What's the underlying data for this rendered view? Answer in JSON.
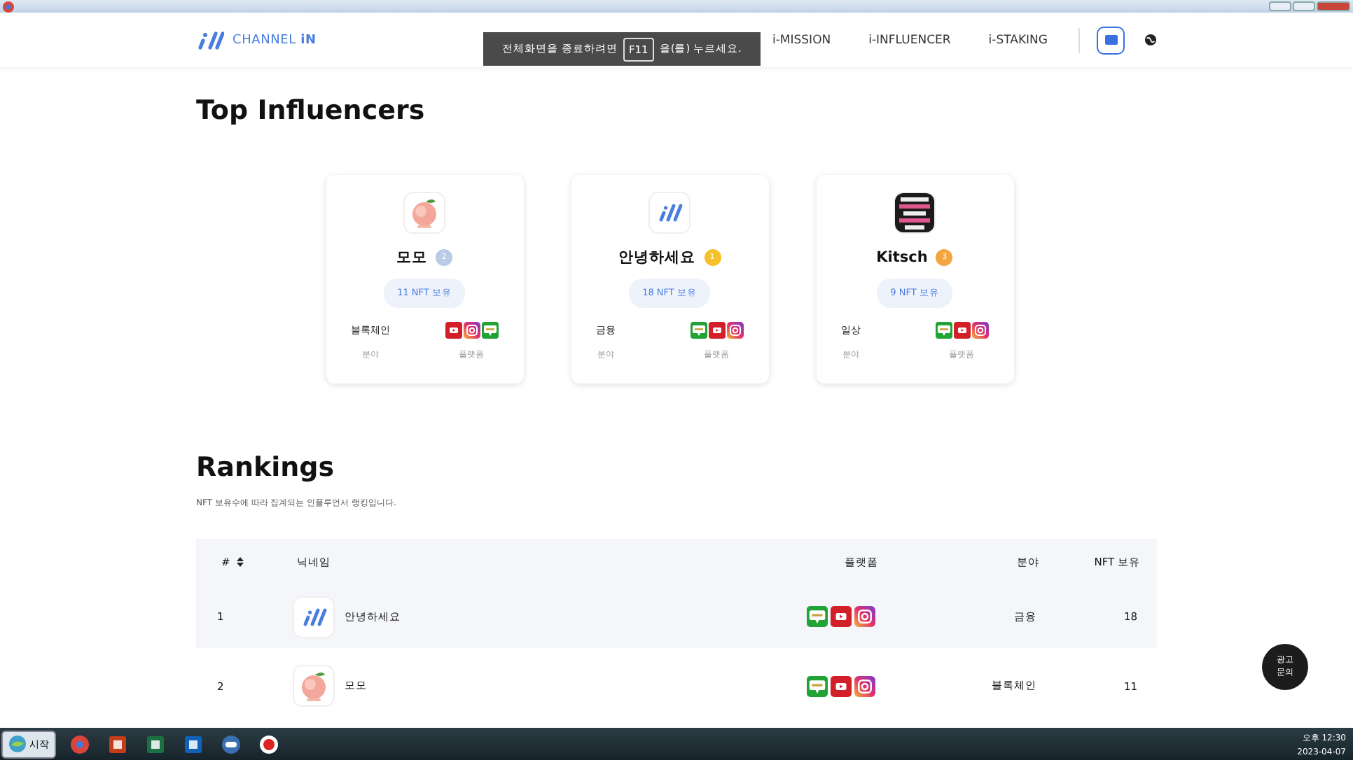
{
  "header": {
    "brand": "CHANNEL **iN**",
    "nav": [
      {
        "label": "i-MISSION"
      },
      {
        "label": "i-INFLUENCER"
      },
      {
        "label": "i-STAKING"
      }
    ]
  },
  "toast": {
    "before": "전체화면을 종료하려면",
    "key": "F11",
    "after": "을(를) 누르세요."
  },
  "top_section": {
    "title": "Top Influencers",
    "cards": [
      {
        "avatar": {
          "kind": "peach"
        },
        "name": "모모",
        "medal": {
          "rank": "2",
          "color": "#b9cbe6"
        },
        "nft": "11 NFT 보유",
        "field": "블록체인",
        "field_label": "분야",
        "platforms": [
          {
            "kind": "youtube"
          },
          {
            "kind": "instagram"
          },
          {
            "kind": "blog"
          }
        ],
        "platform_label": "플랫폼"
      },
      {
        "avatar": {
          "kind": "logo"
        },
        "name": "안녕하세요",
        "medal": {
          "rank": "1",
          "color": "#f5c02a"
        },
        "nft": "18 NFT 보유",
        "field": "금융",
        "field_label": "분야",
        "platforms": [
          {
            "kind": "blog"
          },
          {
            "kind": "youtube"
          },
          {
            "kind": "instagram"
          }
        ],
        "platform_label": "플랫폼"
      },
      {
        "name": "Kitsch",
        "medal": {
          "rank": "3",
          "color": "#f2a540"
        },
        "nft": "9 NFT 보유",
        "field": "일상",
        "field_label": "분야",
        "platforms": [
          {
            "kind": "blog"
          },
          {
            "kind": "youtube"
          },
          {
            "kind": "instagram"
          }
        ],
        "platform_label": "플랫폼"
      }
    ]
  },
  "rankings": {
    "title": "Rankings",
    "subtitle": "NFT 보유수에 따라 집계되는 인플루언서 랭킹입니다.",
    "columns": [
      "#",
      "닉네임",
      "플랫폼",
      "분야",
      "NFT 보유"
    ],
    "rows": [
      {
        "rank": "1",
        "avatar": {
          "kind": "logo"
        },
        "name": "안녕하세요",
        "platforms": [
          {
            "kind": "blog"
          },
          {
            "kind": "youtube"
          },
          {
            "kind": "instagram"
          }
        ],
        "field": "금융",
        "nft": "18"
      },
      {
        "rank": "2",
        "avatar": {
          "kind": "peach"
        },
        "name": "모모",
        "platforms": [
          {
            "kind": "blog"
          },
          {
            "kind": "youtube"
          },
          {
            "kind": "instagram"
          }
        ],
        "field": "블록체인",
        "nft": "11"
      }
    ]
  },
  "float_button": {
    "label": "광고 문의"
  },
  "taskbar": {
    "start": "시작",
    "apps": [
      {
        "kind": "chrome"
      },
      {
        "kind": "powerpoint"
      },
      {
        "kind": "excel"
      },
      {
        "kind": "outlook"
      },
      {
        "kind": "chat"
      },
      {
        "kind": "record"
      }
    ],
    "time": "오후 12:30",
    "date": "2023-04-07"
  }
}
